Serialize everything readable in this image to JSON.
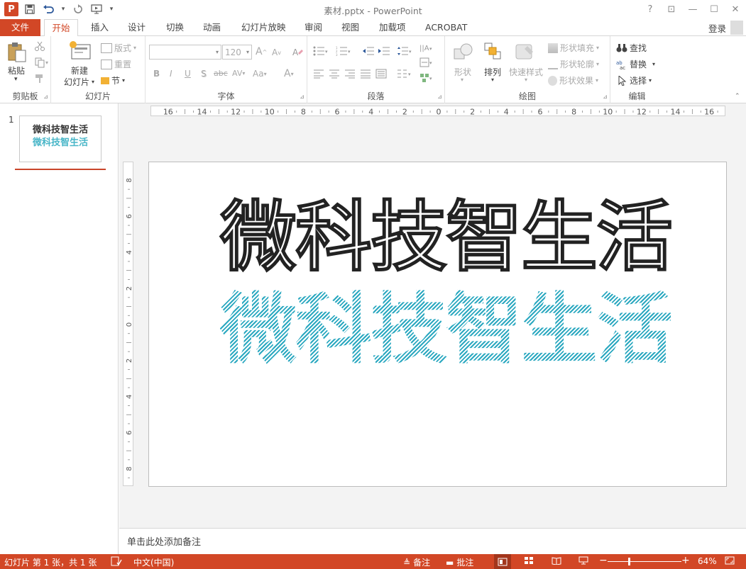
{
  "titlebar": {
    "doc_title": "素材.pptx - PowerPoint",
    "app_logo": "P",
    "help": "?",
    "ribbon_display": "⊡",
    "minimize": "—",
    "maximize": "☐",
    "close": "✕"
  },
  "tabs": {
    "file": "文件",
    "items": [
      "开始",
      "插入",
      "设计",
      "切换",
      "动画",
      "幻灯片放映",
      "审阅",
      "视图",
      "加载项",
      "ACROBAT"
    ],
    "login": "登录"
  },
  "ribbon": {
    "clipboard": {
      "label": "剪贴板",
      "paste": "粘贴"
    },
    "slides": {
      "label": "幻灯片",
      "new_slide_l1": "新建",
      "new_slide_l2": "幻灯片",
      "layout": "版式",
      "reset": "重置",
      "section": "节"
    },
    "font": {
      "label": "字体",
      "font_name": "",
      "font_size": "120",
      "bold": "B",
      "italic": "I",
      "underline": "U",
      "shadow": "S",
      "strike": "abc",
      "spacing": "AV",
      "case": "Aa",
      "grow": "A",
      "shrink": "A"
    },
    "paragraph": {
      "label": "段落"
    },
    "drawing": {
      "label": "绘图",
      "shapes": "形状",
      "arrange": "排列",
      "quick_styles": "快速样式",
      "fill": "形状填充",
      "outline": "形状轮廓",
      "effects": "形状效果"
    },
    "editing": {
      "label": "编辑",
      "find": "查找",
      "replace": "替换",
      "select": "选择"
    }
  },
  "thumbnails": [
    {
      "number": "1",
      "line1": "微科技智生活",
      "line2": "微科技智生活"
    }
  ],
  "ruler": {
    "h_labels": [
      "16",
      "14",
      "12",
      "10",
      "8",
      "6",
      "4",
      "2",
      "0",
      "2",
      "4",
      "6",
      "8",
      "10",
      "12",
      "14",
      "16"
    ],
    "v_labels": [
      "8",
      "6",
      "4",
      "2",
      "0",
      "2",
      "4",
      "6",
      "8"
    ]
  },
  "slide": {
    "title_outline": "微科技智生活",
    "title_hatched": "微科技智生活",
    "hatch_color": "#2ba8c0"
  },
  "notes": {
    "placeholder": "单击此处添加备注"
  },
  "statusbar": {
    "slide_info": "幻灯片 第 1 张，共 1 张",
    "language": "中文(中国)",
    "notes": "备注",
    "comments": "批注",
    "zoom_level": "64%"
  },
  "colors": {
    "accent": "#d24726"
  }
}
